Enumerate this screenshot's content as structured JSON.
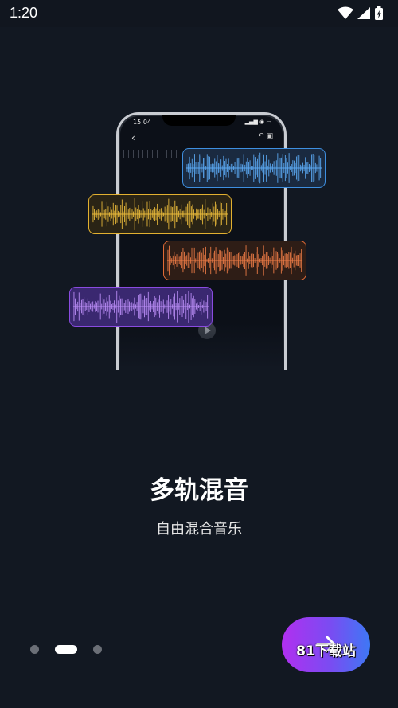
{
  "status_bar": {
    "time": "1:20",
    "icons": [
      "wifi-icon",
      "signal-icon",
      "battery-charging-icon"
    ]
  },
  "illustration": {
    "phone_time": "15:04",
    "tracks": [
      {
        "name": "blue-track",
        "color": "#3e8fe0"
      },
      {
        "name": "yellow-track",
        "color": "#e2b030"
      },
      {
        "name": "orange-track",
        "color": "#e06a35"
      },
      {
        "name": "purple-track",
        "color": "#8a4be0"
      }
    ]
  },
  "content": {
    "title": "多轨混音",
    "subtitle": "自由混合音乐"
  },
  "pager": {
    "total": 3,
    "current": 2
  },
  "next_button": {
    "icon": "arrow-right-icon",
    "watermark": "81下载站",
    "gradient": [
      "#b12ff0",
      "#3e78f5"
    ]
  }
}
